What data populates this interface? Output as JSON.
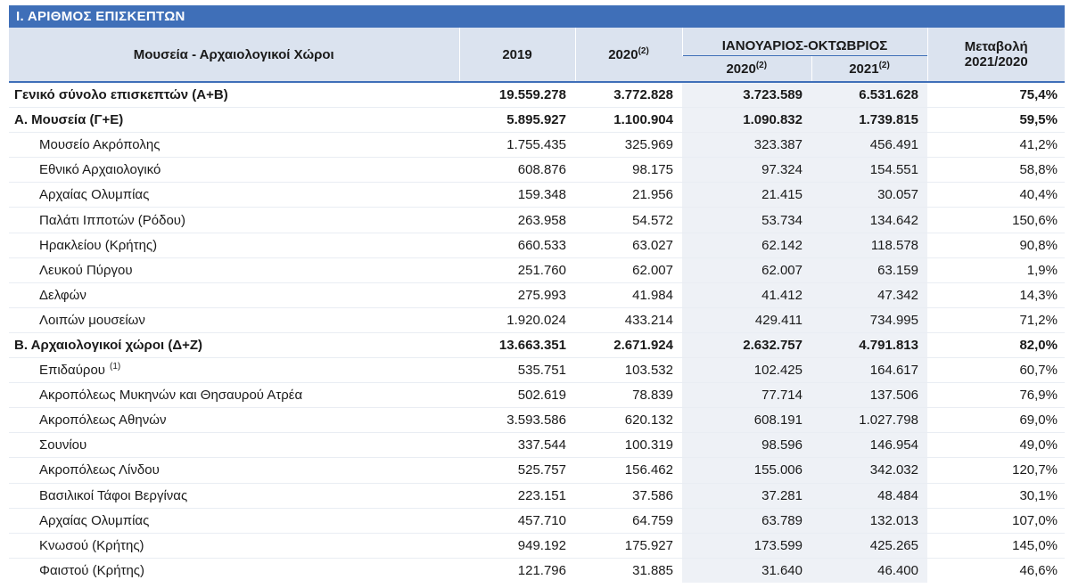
{
  "title": "Ι. ΑΡΙΘΜΟΣ ΕΠΙΣΚΕΠΤΩΝ",
  "header": {
    "name_col": "Μουσεία - Αρχαιολογικοί Χώροι",
    "y2019": "2019",
    "y2020": "2020",
    "y2020_sup": "(2)",
    "period_group": "ΙΑΝΟΥΑΡΙΟΣ-ΟΚΤΩΒΡΙΟΣ",
    "period_2020": "2020",
    "period_2020_sup": "(2)",
    "period_2021": "2021",
    "period_2021_sup": "(2)",
    "change_line1": "Μεταβολή",
    "change_line2": "2021/2020"
  },
  "rows": [
    {
      "name": "Γενικό  σύνολο επισκεπτών (Α+Β)",
      "sup": "",
      "y2019": "19.559.278",
      "y2020": "3.772.828",
      "p2020": "3.723.589",
      "p2021": "6.531.628",
      "change": "75,4%",
      "bold": true
    },
    {
      "name": "Α. Μουσεία (Γ+Ε)",
      "sup": "",
      "y2019": "5.895.927",
      "y2020": "1.100.904",
      "p2020": "1.090.832",
      "p2021": "1.739.815",
      "change": "59,5%",
      "bold": true
    },
    {
      "name": "Μουσείο Ακρόπολης",
      "sup": "",
      "y2019": "1.755.435",
      "y2020": "325.969",
      "p2020": "323.387",
      "p2021": "456.491",
      "change": "41,2%",
      "bold": false
    },
    {
      "name": "Εθνικό Αρχαιολογικό",
      "sup": "",
      "y2019": "608.876",
      "y2020": "98.175",
      "p2020": "97.324",
      "p2021": "154.551",
      "change": "58,8%",
      "bold": false
    },
    {
      "name": "Αρχαίας Ολυμπίας",
      "sup": "",
      "y2019": "159.348",
      "y2020": "21.956",
      "p2020": "21.415",
      "p2021": "30.057",
      "change": "40,4%",
      "bold": false
    },
    {
      "name": "Παλάτι Ιπποτών (Ρόδου)",
      "sup": "",
      "y2019": "263.958",
      "y2020": "54.572",
      "p2020": "53.734",
      "p2021": "134.642",
      "change": "150,6%",
      "bold": false
    },
    {
      "name": "Ηρακλείου (Κρήτης)",
      "sup": "",
      "y2019": "660.533",
      "y2020": "63.027",
      "p2020": "62.142",
      "p2021": "118.578",
      "change": "90,8%",
      "bold": false
    },
    {
      "name": "Λευκού Πύργου",
      "sup": "",
      "y2019": "251.760",
      "y2020": "62.007",
      "p2020": "62.007",
      "p2021": "63.159",
      "change": "1,9%",
      "bold": false
    },
    {
      "name": "Δελφών",
      "sup": "",
      "y2019": "275.993",
      "y2020": "41.984",
      "p2020": "41.412",
      "p2021": "47.342",
      "change": "14,3%",
      "bold": false
    },
    {
      "name": "Λοιπών μουσείων",
      "sup": "",
      "y2019": "1.920.024",
      "y2020": "433.214",
      "p2020": "429.411",
      "p2021": "734.995",
      "change": "71,2%",
      "bold": false
    },
    {
      "name": "Β. Αρχαιολογικοί χώροι (Δ+Ζ)",
      "sup": "",
      "y2019": "13.663.351",
      "y2020": "2.671.924",
      "p2020": "2.632.757",
      "p2021": "4.791.813",
      "change": "82,0%",
      "bold": true
    },
    {
      "name": "Επιδαύρου",
      "sup": "(1)",
      "y2019": "535.751",
      "y2020": "103.532",
      "p2020": "102.425",
      "p2021": "164.617",
      "change": "60,7%",
      "bold": false
    },
    {
      "name": "Ακροπόλεως Μυκηνών και Θησαυρού Ατρέα",
      "sup": "",
      "y2019": "502.619",
      "y2020": "78.839",
      "p2020": "77.714",
      "p2021": "137.506",
      "change": "76,9%",
      "bold": false
    },
    {
      "name": "Ακροπόλεως Αθηνών",
      "sup": "",
      "y2019": "3.593.586",
      "y2020": "620.132",
      "p2020": "608.191",
      "p2021": "1.027.798",
      "change": "69,0%",
      "bold": false
    },
    {
      "name": "Σουνίου",
      "sup": "",
      "y2019": "337.544",
      "y2020": "100.319",
      "p2020": "98.596",
      "p2021": "146.954",
      "change": "49,0%",
      "bold": false
    },
    {
      "name": "Ακροπόλεως Λίνδου",
      "sup": "",
      "y2019": "525.757",
      "y2020": "156.462",
      "p2020": "155.006",
      "p2021": "342.032",
      "change": "120,7%",
      "bold": false
    },
    {
      "name": "Βασιλικοί Τάφοι Βεργίνας",
      "sup": "",
      "y2019": "223.151",
      "y2020": "37.586",
      "p2020": "37.281",
      "p2021": "48.484",
      "change": "30,1%",
      "bold": false
    },
    {
      "name": "Αρχαίας Ολυμπίας",
      "sup": "",
      "y2019": "457.710",
      "y2020": "64.759",
      "p2020": "63.789",
      "p2021": "132.013",
      "change": "107,0%",
      "bold": false
    },
    {
      "name": "Κνωσού (Κρήτης)",
      "sup": "",
      "y2019": "949.192",
      "y2020": "175.927",
      "p2020": "173.599",
      "p2021": "425.265",
      "change": "145,0%",
      "bold": false
    },
    {
      "name": "Φαιστού (Κρήτης)",
      "sup": "",
      "y2019": "121.796",
      "y2020": "31.885",
      "p2020": "31.640",
      "p2021": "46.400",
      "change": "46,6%",
      "bold": false
    }
  ]
}
